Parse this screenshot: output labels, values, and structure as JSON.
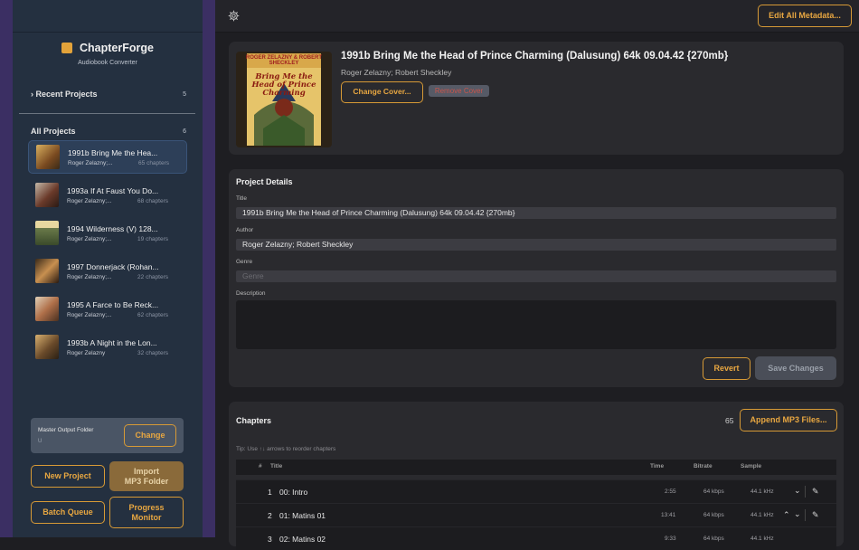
{
  "sidebar": {
    "app_name": "ChapterForge",
    "app_subtitle": "Audiobook Converter",
    "recent_label": "Recent Projects",
    "recent_count": "5",
    "all_label": "All Projects",
    "all_count": "6",
    "projects": [
      {
        "title": "1991b   Bring Me the Hea...",
        "author": "Roger Zelazny;...",
        "chapters": "65 chapters",
        "selected": true
      },
      {
        "title": "1993a   If At Faust You Do...",
        "author": "Roger Zelazny;...",
        "chapters": "68 chapters"
      },
      {
        "title": "1994   Wilderness (V) 128...",
        "author": "Roger Zelazny;...",
        "chapters": "19 chapters"
      },
      {
        "title": "1997   Donnerjack (Rohan...",
        "author": "Roger Zelazny;...",
        "chapters": "22 chapters"
      },
      {
        "title": "1995   A Farce to Be Reck...",
        "author": "Roger Zelazny;...",
        "chapters": "62 chapters"
      },
      {
        "title": "1993b   A Night in the Lon...",
        "author": "Roger Zelazny",
        "chapters": "32 chapters"
      }
    ],
    "output_label": "Master Output Folder",
    "output_value": "U",
    "change_label": "Change",
    "new_project_label": "New Project",
    "import_label": "Import\nMP3 Folder",
    "batch_label": "Batch Queue",
    "progress_label": "Progress\nMonitor"
  },
  "header": {
    "edit_all_label": "Edit All Metadata..."
  },
  "book": {
    "title": "1991b   Bring Me the Head of Prince Charming (Dalusung) 64k 09.04.42 {270mb}",
    "author": "Roger Zelazny; Robert Sheckley",
    "change_cover_label": "Change Cover...",
    "remove_cover_label": "Remove Cover",
    "cover_text_top": "ROGER ZELAZNY & ROBERT SHECKLEY",
    "cover_text_title": "Bring Me the Head of Prince Charming"
  },
  "details": {
    "section_title": "Project Details",
    "title_label": "Title",
    "title_value": "1991b   Bring Me the Head of Prince Charming (Dalusung) 64k 09.04.42 {270mb}",
    "author_label": "Author",
    "author_value": "Roger Zelazny; Robert Sheckley",
    "genre_label": "Genre",
    "genre_placeholder": "Genre",
    "description_label": "Description",
    "revert_label": "Revert",
    "save_label": "Save Changes"
  },
  "chapters": {
    "section_title": "Chapters",
    "count": "65",
    "append_label": "Append MP3 Files...",
    "tip": "Tip: Use ↑↓ arrows to reorder chapters",
    "columns": {
      "num": "#",
      "title": "Title",
      "time": "Time",
      "bitrate": "Bitrate",
      "sample": "Sample"
    },
    "rows": [
      {
        "num": "1",
        "title": "00: Intro",
        "time": "2:55",
        "bitrate": "64 kbps",
        "sample": "44.1 kHz"
      },
      {
        "num": "2",
        "title": "01: Matins 01",
        "time": "13:41",
        "bitrate": "64 kbps",
        "sample": "44.1 kHz"
      },
      {
        "num": "3",
        "title": "02: Matins 02",
        "time": "9:33",
        "bitrate": "64 kbps",
        "sample": "44.1 kHz"
      }
    ]
  },
  "colors": {
    "accent": "#e8a741",
    "sidebar": "#243040",
    "purple_strip": "#3b2f63"
  }
}
